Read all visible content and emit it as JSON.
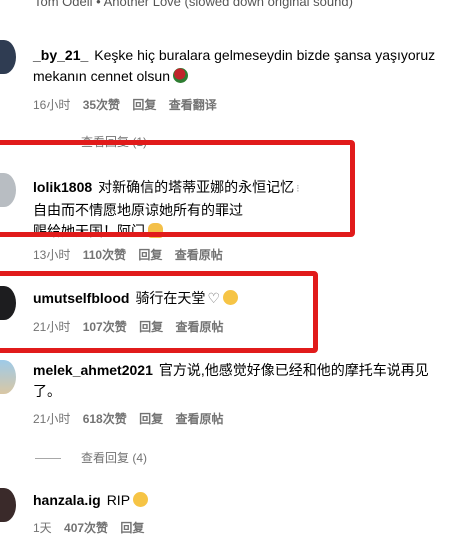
{
  "top_line": "Tom Odell • Another Love (slowed down original sound)",
  "colors": {
    "highlight": "#e11b1b",
    "meta": "#737373"
  },
  "comments": [
    {
      "user": "_by_21_",
      "text_lines": [
        "Keşke hiç buralara gelmeseydin bizde şansa yaşıyoruz",
        "mekanın cennet olsun"
      ],
      "emoji": "rose-icon",
      "time": "16小时",
      "likes": "35次赞",
      "reply": "回复",
      "action": "查看翻译"
    },
    {
      "user": "lolik1808",
      "text_lines": [
        "对新确信的塔蒂亚娜的永恒记忆",
        "自由而不情愿地原谅她所有的罪过",
        "赐给她天国！阿门"
      ],
      "emoji": "praying-hands-icon",
      "time": "13小时",
      "likes": "110次赞",
      "reply": "回复",
      "action": "查看原帖",
      "view_replies": "查看回复 (1)"
    },
    {
      "user": "umutselfblood",
      "text_lines": [
        "骑行在天堂"
      ],
      "emoji": "sad-face-icon",
      "time": "21小时",
      "likes": "107次赞",
      "reply": "回复",
      "action": "查看原帖"
    },
    {
      "user": "melek_ahmet2021",
      "text_lines": [
        "官方说,他感觉好像已经和他的摩托车说再见",
        "了。"
      ],
      "time": "21小时",
      "likes": "618次赞",
      "reply": "回复",
      "action": "查看原帖",
      "view_replies": "查看回复 (4)"
    },
    {
      "user": "hanzala.ig",
      "text_lines": [
        "RIP"
      ],
      "emoji": "sad-face-icon",
      "time": "1天",
      "likes": "407次赞",
      "reply": "回复"
    }
  ]
}
